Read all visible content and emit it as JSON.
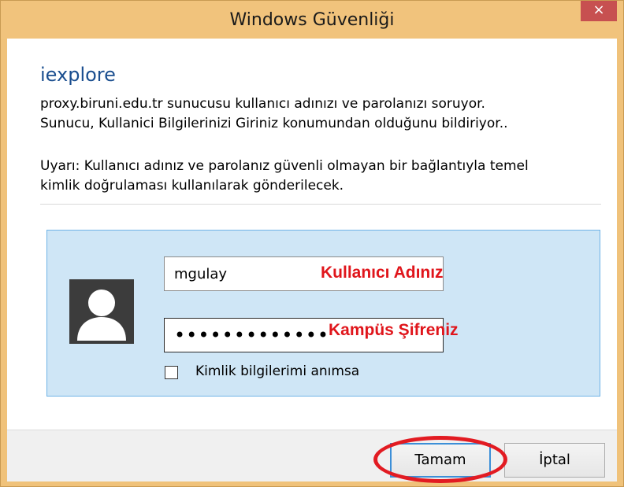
{
  "window": {
    "title": "Windows Güvenliği",
    "close_label": "×"
  },
  "dialog": {
    "app_name": "iexplore",
    "message_line1": "proxy.biruni.edu.tr sunucusu kullanıcı adınızı ve parolanızı soruyor.",
    "message_line2": "Sunucu, Kullanici Bilgilerinizi Giriniz konumundan olduğunu bildiriyor..",
    "warning_line1": "Uyarı: Kullanıcı adınız ve parolanız güvenli olmayan bir bağlantıyla temel",
    "warning_line2": "kimlik doğrulaması kullanılarak gönderilecek."
  },
  "credentials": {
    "username_value": "mgulay",
    "password_mask": "•••••••••••••",
    "remember_label": "Kimlik bilgilerimi anımsa",
    "remember_checked": false
  },
  "annotations": {
    "username_note": "Kullanıcı Adınız",
    "password_note": "Kampüs Şifreniz",
    "color": "#e0151b"
  },
  "buttons": {
    "ok_label": "Tamam",
    "cancel_label": "İptal"
  },
  "icons": {
    "close": "close-icon",
    "avatar": "user-avatar-icon"
  },
  "colors": {
    "titlebar": "#f1c37c",
    "close_button": "#c75050",
    "app_name": "#1a4e8f",
    "panel_bg": "#cfe6f6",
    "panel_border": "#6fb3e6"
  }
}
